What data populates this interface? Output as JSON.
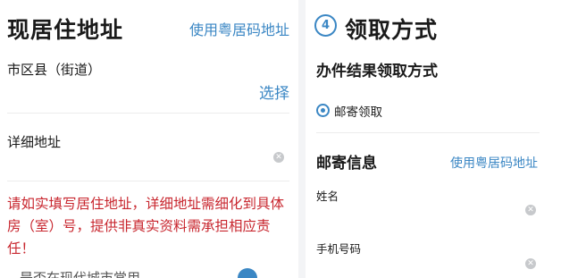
{
  "left": {
    "title": "现居住地址",
    "use_cantonese_address": "使用粤居码地址",
    "district_label": "市区县（街道）",
    "select_label": "选择",
    "detail_label": "详细地址",
    "detail_value": "",
    "warning": "请如实填写居住地址，详细地址需细化到具体房（室）号，提供非真实资料需承担相应责任！",
    "cut_off_text": "是否在现代城市常用"
  },
  "right": {
    "step_number": "4",
    "title": "领取方式",
    "subtitle": "办件结果领取方式",
    "option_mail": "邮寄领取",
    "mail_info_title": "邮寄信息",
    "use_cantonese_address": "使用粤居码地址",
    "name_label": "姓名",
    "name_value": "",
    "phone_label": "手机号码",
    "phone_value": ""
  },
  "colors": {
    "accent": "#3b87c4",
    "warning": "#c8262e"
  },
  "icons": {
    "clear": "clear-circle-icon",
    "radio": "radio-selected-icon"
  }
}
